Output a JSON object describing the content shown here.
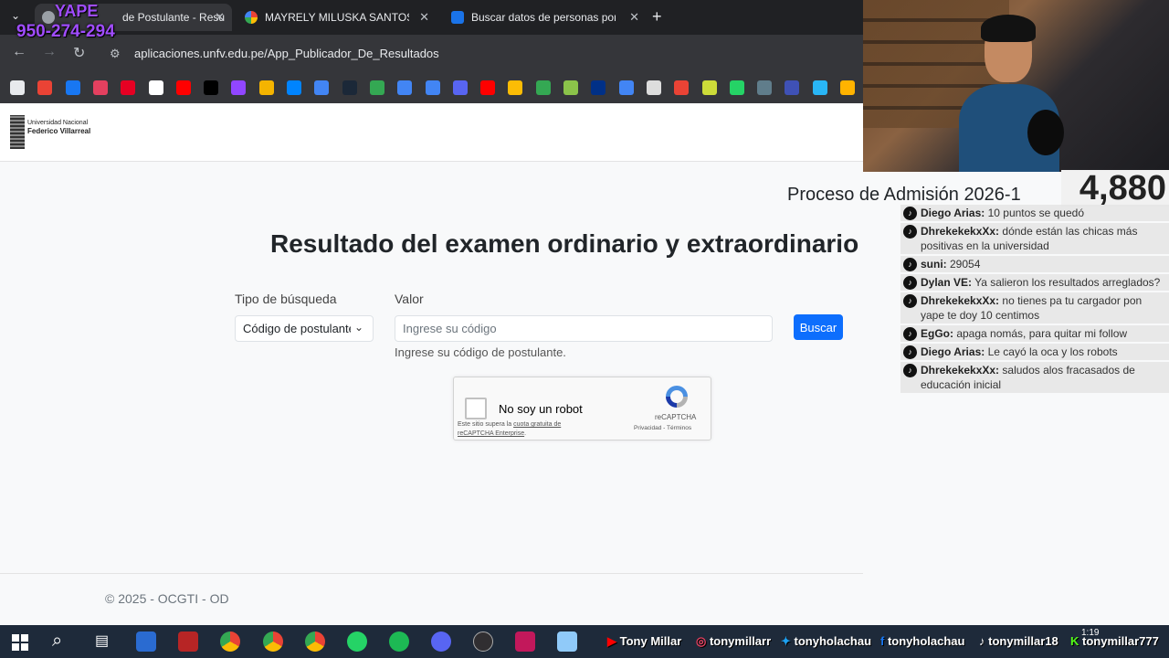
{
  "browser": {
    "tabs": [
      {
        "title": "de Postulante - Resu",
        "active": true
      },
      {
        "title": "MAYRELY MILUSKA SANTOS CA",
        "active": false
      },
      {
        "title": "Buscar datos de personas por D",
        "active": false
      }
    ],
    "new_tab_label": "+",
    "url": "aplicaciones.unfv.edu.pe/App_Publicador_De_Resultados",
    "bookmark_icons": [
      "chatgpt-icon",
      "gmail-icon",
      "facebook-icon",
      "instagram-icon",
      "pinterest-icon",
      "x-icon",
      "youtube-icon",
      "tiktok-icon",
      "twitch-icon",
      "photos-icon",
      "messenger-icon",
      "app-icon",
      "steam-icon",
      "maps-icon",
      "translate-icon",
      "docs-icon",
      "discord-icon",
      "youtube-music-icon",
      "drive-icon",
      "app-icon",
      "app-icon",
      "paypal-icon",
      "app-icon",
      "app-icon",
      "alert-icon",
      "app-icon",
      "app-icon",
      "app-icon",
      "app-icon",
      "app-icon",
      "app-icon"
    ]
  },
  "site": {
    "logo_line1": "Universidad Nacional",
    "logo_line2": "Federico Villarreal",
    "process_title": "Proceso de Admisión 2026-1",
    "main_title": "Resultado del examen ordinario y extraordinario",
    "search_type_label": "Tipo de búsqueda",
    "search_type_value": "Código de postulante",
    "value_label": "Valor",
    "value_placeholder": "Ingrese su código",
    "help_text": "Ingrese su código de postulante.",
    "search_button": "Buscar",
    "captcha": {
      "label": "No soy un robot",
      "note_prefix": "Este sitio supera la ",
      "note_link": "cuota gratuita de reCAPTCHA Enterprise",
      "note_suffix": ".",
      "brand": "reCAPTCHA",
      "links": "Privacidad - Términos"
    },
    "footer": "© 2025 - OCGTI - OD"
  },
  "overlay": {
    "yape_line1": "YAPE",
    "yape_line2": "950-274-294",
    "counter": "4,880",
    "chat": [
      {
        "user": "Diego Arias:",
        "text": " 10 puntos se quedó"
      },
      {
        "user": "DhrekekekxXx:",
        "text": " dónde están las chicas más positivas en la universidad"
      },
      {
        "user": "suni:",
        "text": " 29054"
      },
      {
        "user": "Dylan VE:",
        "text": " Ya salieron los resultados arreglados?"
      },
      {
        "user": "DhrekekekxXx:",
        "text": " no tienes pa tu cargador pon yape te doy 10 centimos"
      },
      {
        "user": "EgGo:",
        "text": " apaga nomás, para quitar mi follow"
      },
      {
        "user": "Diego Arias:",
        "text": " Le cayó la oca y los robots"
      },
      {
        "user": "DhrekekekxXx:",
        "text": " saludos alos fracasados de educación inicial"
      }
    ]
  },
  "taskbar": {
    "handles": [
      "Tony Millar",
      "tonymillarr",
      "tonyholachau",
      "tonyholachau",
      "tonymillar18",
      "tonymillar777"
    ],
    "clock": "1:19"
  }
}
